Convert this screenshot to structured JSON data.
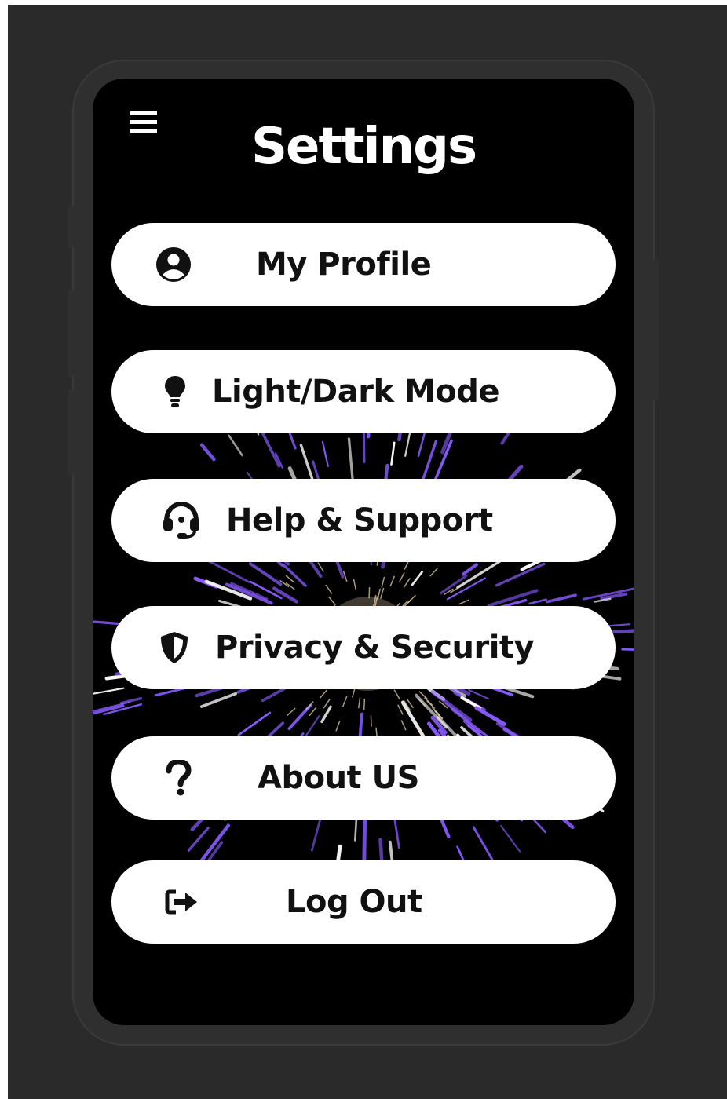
{
  "header": {
    "title": "Settings",
    "menu_icon": "hamburger-menu-icon"
  },
  "menu": {
    "items": [
      {
        "label": "My Profile",
        "icon": "user-circle-icon"
      },
      {
        "label": "Light/Dark Mode",
        "icon": "lightbulb-icon"
      },
      {
        "label": "Help & Support",
        "icon": "headset-icon"
      },
      {
        "label": "Privacy & Security",
        "icon": "shield-icon"
      },
      {
        "label": "About US",
        "icon": "question-mark-icon"
      },
      {
        "label": "Log Out",
        "icon": "logout-icon"
      }
    ]
  },
  "colors": {
    "backdrop": "#2a2a2a",
    "phone_frame": "#2f2f2f",
    "screen": "#000000",
    "pill": "#ffffff",
    "pill_text": "#111111",
    "title": "#ffffff",
    "firework_primary": "#8a5cff",
    "firework_secondary": "#ffffff"
  }
}
